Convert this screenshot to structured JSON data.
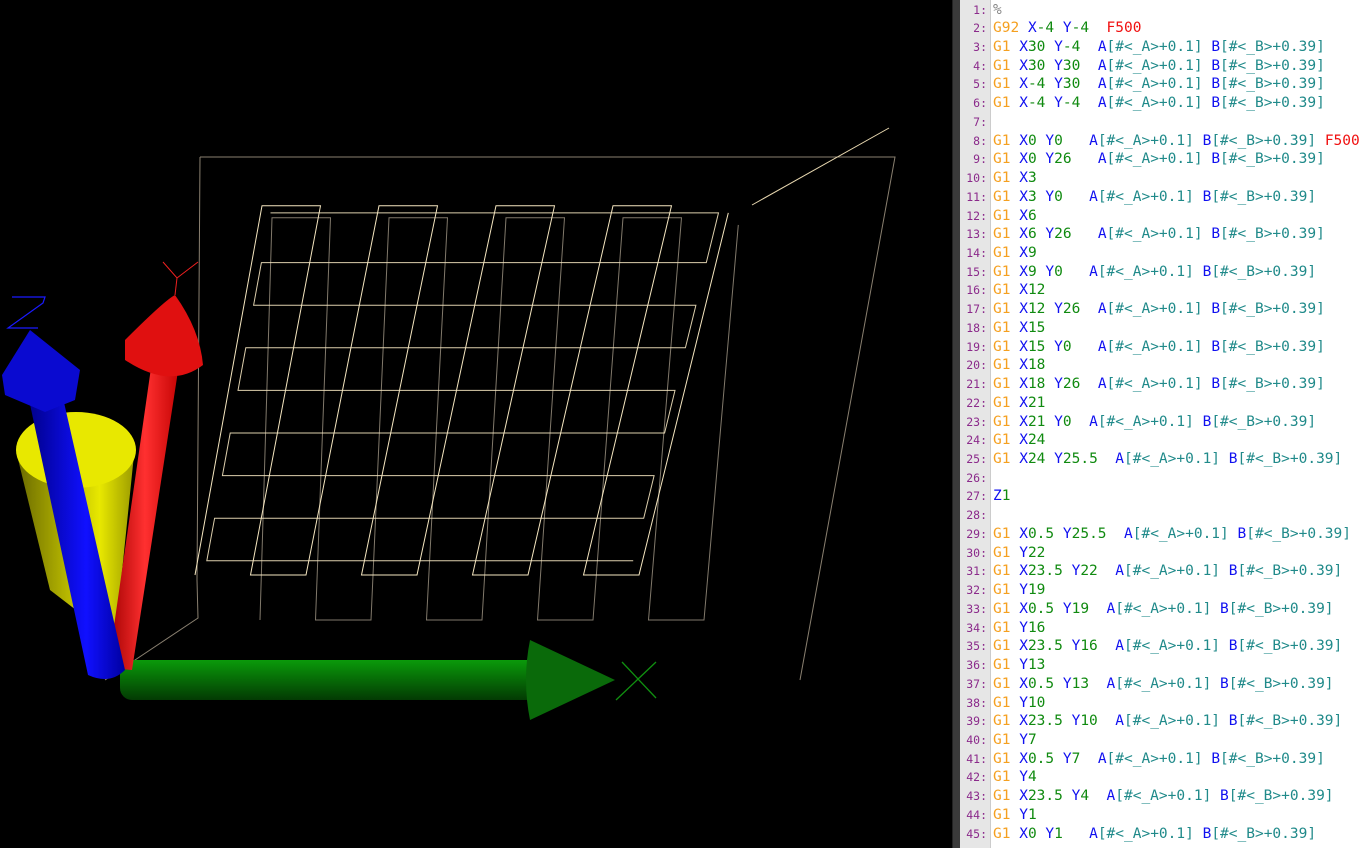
{
  "viewport": {
    "axis_labels": {
      "x": "X",
      "y": "Y",
      "z": "Z"
    },
    "colors": {
      "x_axis": "#0a8a0a",
      "y_axis": "#ff1010",
      "z_axis": "#1010e0",
      "tool": "#e8e800",
      "path": "#f5e6c0"
    }
  },
  "editor": {
    "lines": [
      "%",
      "G92 X-4 Y-4  F500",
      "G1 X30 Y-4  A[#<_A>+0.1] B[#<_B>+0.39]",
      "G1 X30 Y30  A[#<_A>+0.1] B[#<_B>+0.39]",
      "G1 X-4 Y30  A[#<_A>+0.1] B[#<_B>+0.39]",
      "G1 X-4 Y-4  A[#<_A>+0.1] B[#<_B>+0.39]",
      "",
      "G1 X0 Y0   A[#<_A>+0.1] B[#<_B>+0.39] F500",
      "G1 X0 Y26   A[#<_A>+0.1] B[#<_B>+0.39]",
      "G1 X3",
      "G1 X3 Y0   A[#<_A>+0.1] B[#<_B>+0.39]",
      "G1 X6",
      "G1 X6 Y26   A[#<_A>+0.1] B[#<_B>+0.39]",
      "G1 X9",
      "G1 X9 Y0   A[#<_A>+0.1] B[#<_B>+0.39]",
      "G1 X12",
      "G1 X12 Y26  A[#<_A>+0.1] B[#<_B>+0.39]",
      "G1 X15",
      "G1 X15 Y0   A[#<_A>+0.1] B[#<_B>+0.39]",
      "G1 X18",
      "G1 X18 Y26  A[#<_A>+0.1] B[#<_B>+0.39]",
      "G1 X21",
      "G1 X21 Y0  A[#<_A>+0.1] B[#<_B>+0.39]",
      "G1 X24",
      "G1 X24 Y25.5  A[#<_A>+0.1] B[#<_B>+0.39]",
      "",
      "Z1",
      "",
      "G1 X0.5 Y25.5  A[#<_A>+0.1] B[#<_B>+0.39]",
      "G1 Y22",
      "G1 X23.5 Y22  A[#<_A>+0.1] B[#<_B>+0.39]",
      "G1 Y19",
      "G1 X0.5 Y19  A[#<_A>+0.1] B[#<_B>+0.39]",
      "G1 Y16",
      "G1 X23.5 Y16  A[#<_A>+0.1] B[#<_B>+0.39]",
      "G1 Y13",
      "G1 X0.5 Y13  A[#<_A>+0.1] B[#<_B>+0.39]",
      "G1 Y10",
      "G1 X23.5 Y10  A[#<_A>+0.1] B[#<_B>+0.39]",
      "G1 Y7",
      "G1 X0.5 Y7  A[#<_A>+0.1] B[#<_B>+0.39]",
      "G1 Y4",
      "G1 X23.5 Y4  A[#<_A>+0.1] B[#<_B>+0.39]",
      "G1 Y1",
      "G1 X0 Y1   A[#<_A>+0.1] B[#<_B>+0.39]"
    ]
  }
}
